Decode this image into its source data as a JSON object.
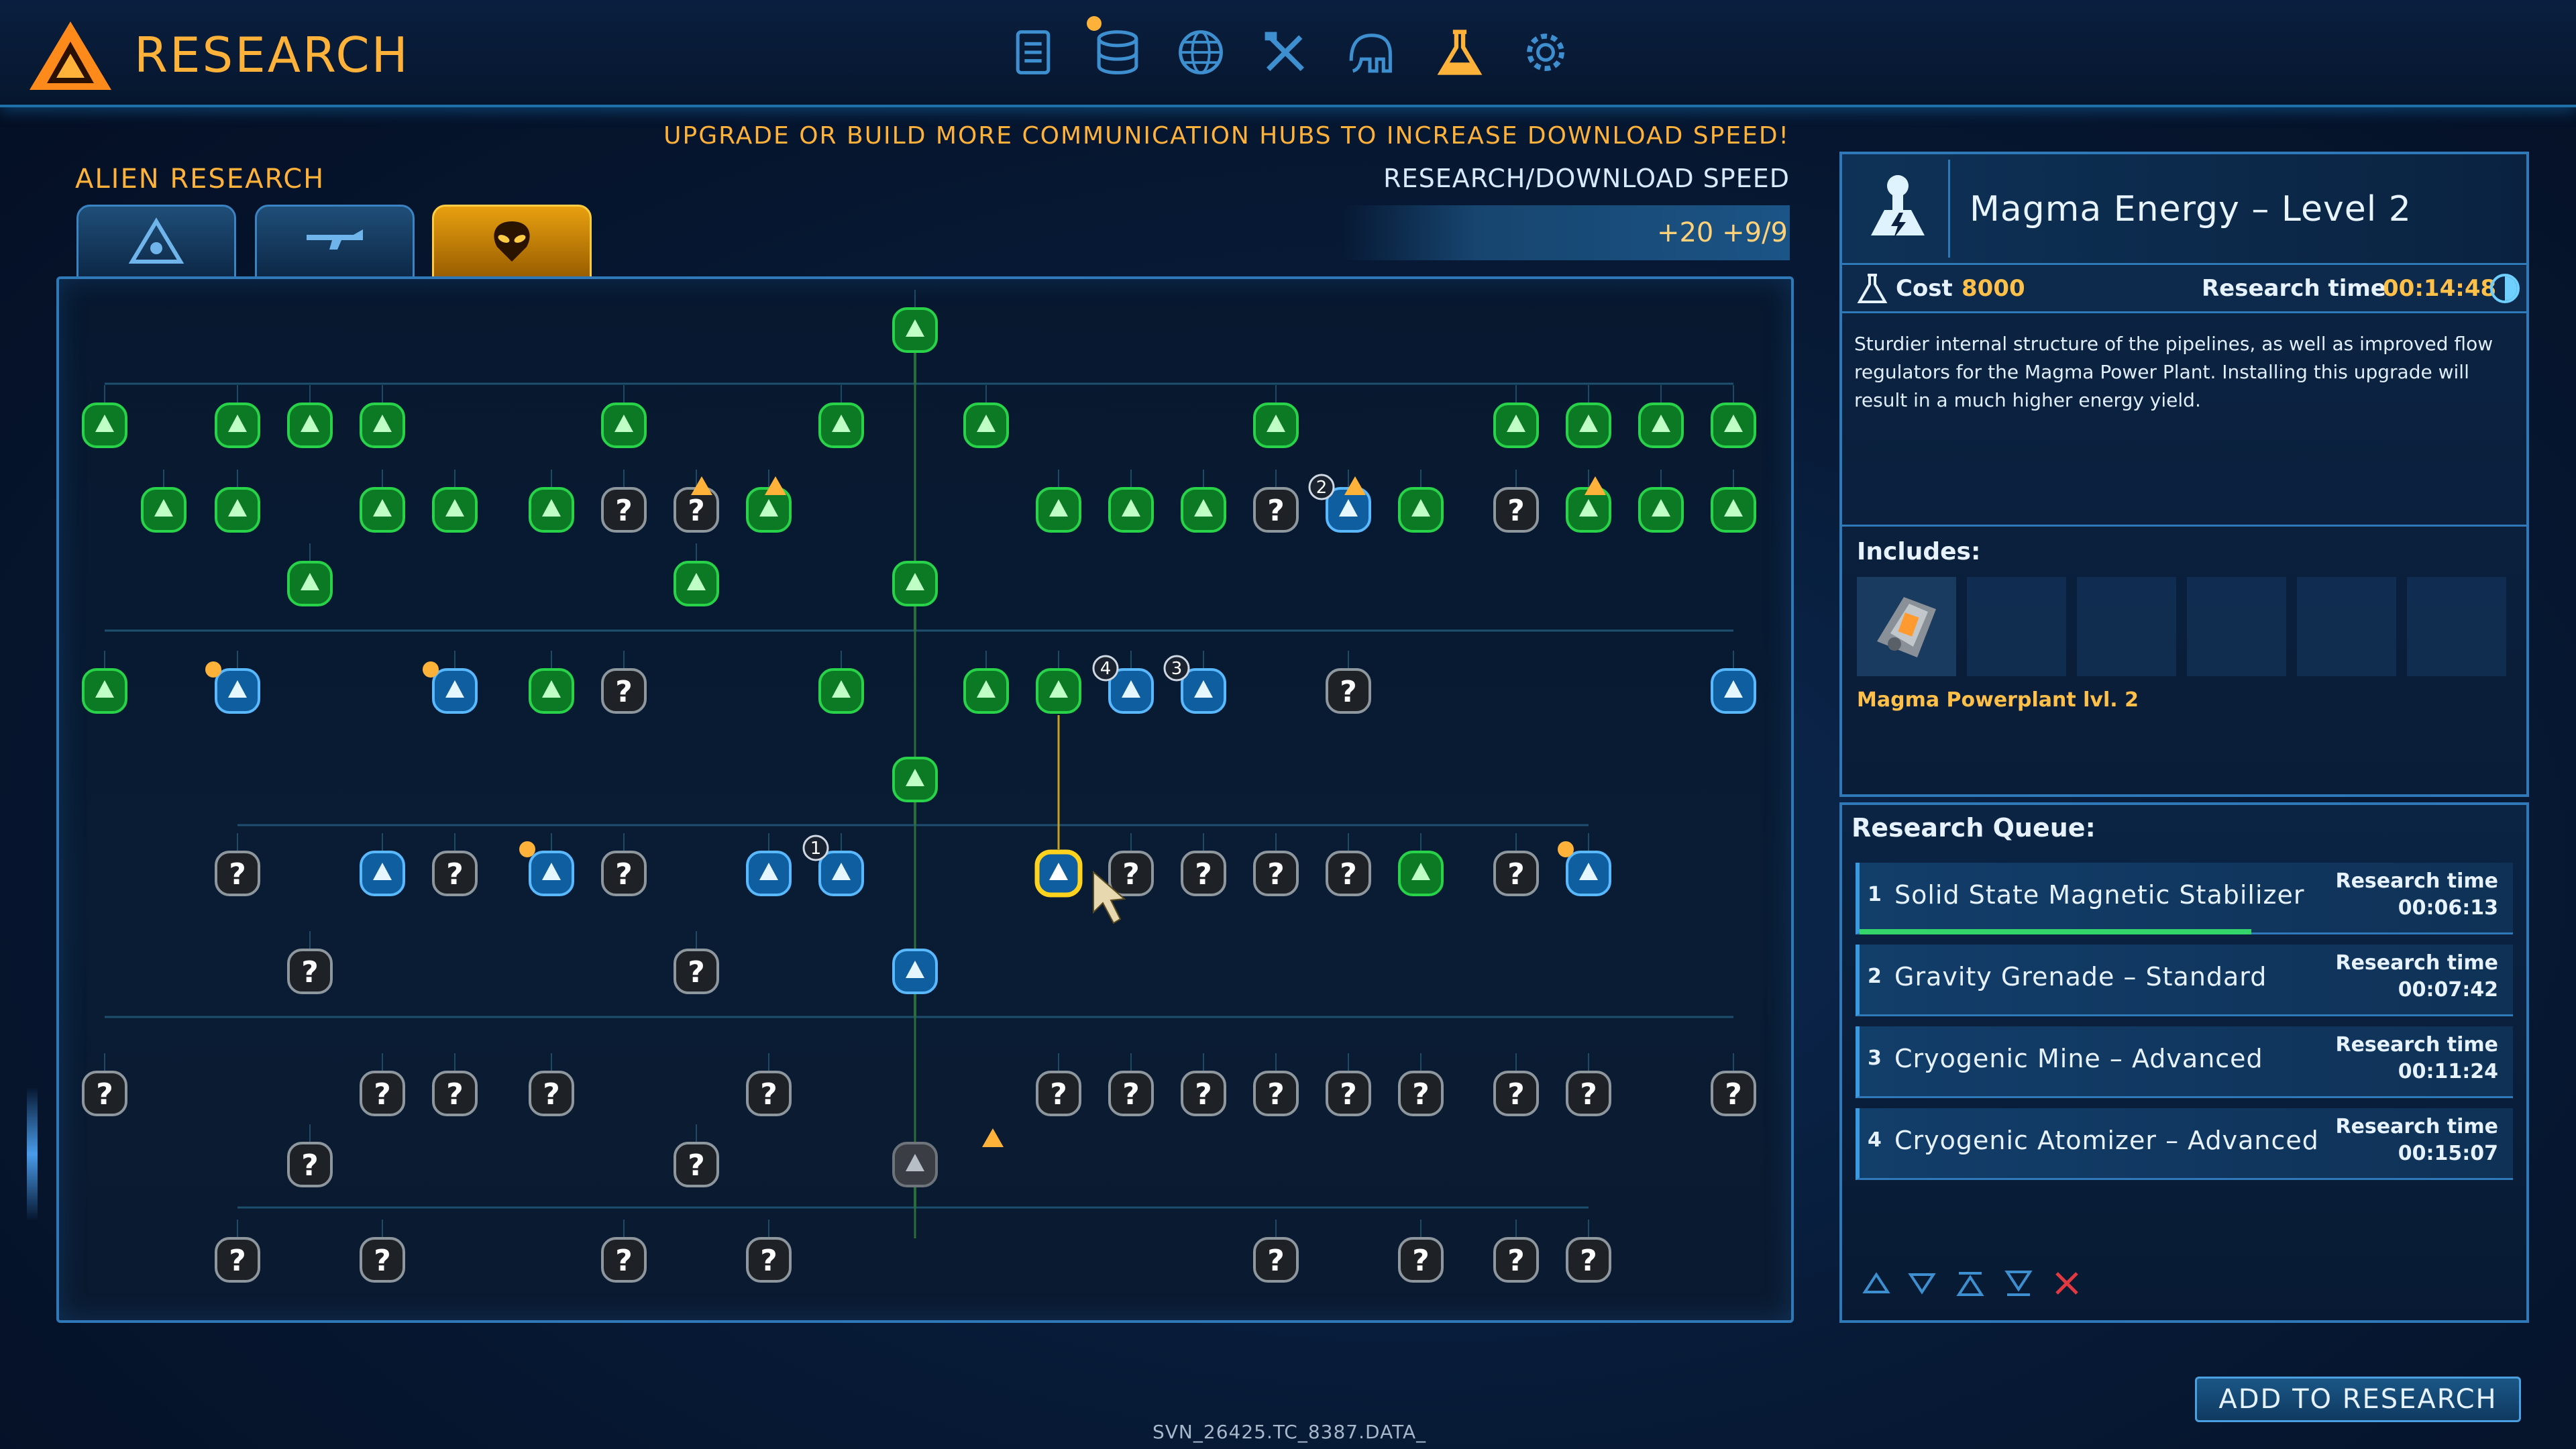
{
  "header": {
    "title": "RESEARCH",
    "nav_icons": [
      "list-icon",
      "database-icon",
      "globe-icon",
      "tools-icon",
      "elephant-icon",
      "flask-icon",
      "gear-icon"
    ],
    "active_nav": "flask-icon",
    "accent_color": "#ffb23a"
  },
  "left": {
    "section_label": "ALIEN RESEARCH",
    "tabs": [
      {
        "icon": "alien-tech-icon",
        "active": false
      },
      {
        "icon": "weapon-icon",
        "active": false
      },
      {
        "icon": "alien-head-icon",
        "active": true
      }
    ],
    "hint": "UPGRADE OR BUILD MORE COMMUNICATION HUBS TO INCREASE DOWNLOAD SPEED!",
    "speed_label": "RESEARCH/DOWNLOAD SPEED",
    "speed_values": "+20  +9/9"
  },
  "tree": {
    "node_badges": [
      "2",
      "4",
      "3",
      "1"
    ],
    "unknown_symbol": "?"
  },
  "detail": {
    "title": "Magma Energy – Level 2",
    "cost_label": "Cost",
    "cost_value": "8000",
    "time_label": "Research time",
    "time_value": "00:14:48",
    "description": "Sturdier internal structure of the pipelines, as well as improved flow regulators for the Magma Power Plant. Installing this upgrade will result in a much higher energy yield.",
    "includes_label": "Includes:",
    "includes_item": "Magma Powerplant lvl. 2"
  },
  "queue": {
    "title": "Research Queue:",
    "items": [
      {
        "num": "1",
        "name": "Solid State Magnetic Stabilizer",
        "time_label": "Research time",
        "time": "00:06:13",
        "progress": 0.6
      },
      {
        "num": "2",
        "name": "Gravity Grenade – Standard",
        "time_label": "Research time",
        "time": "00:07:42",
        "progress": 0
      },
      {
        "num": "3",
        "name": "Cryogenic Mine – Advanced",
        "time_label": "Research time",
        "time": "00:11:24",
        "progress": 0
      },
      {
        "num": "4",
        "name": "Cryogenic Atomizer – Advanced",
        "time_label": "Research time",
        "time": "00:15:07",
        "progress": 0
      }
    ],
    "controls": [
      "move-up-icon",
      "move-down-icon",
      "move-top-icon",
      "move-bottom-icon",
      "remove-icon"
    ]
  },
  "actions": {
    "add_button": "ADD TO RESEARCH"
  },
  "footer": {
    "code": "SVN_26425.TC_8387.DATA_"
  }
}
